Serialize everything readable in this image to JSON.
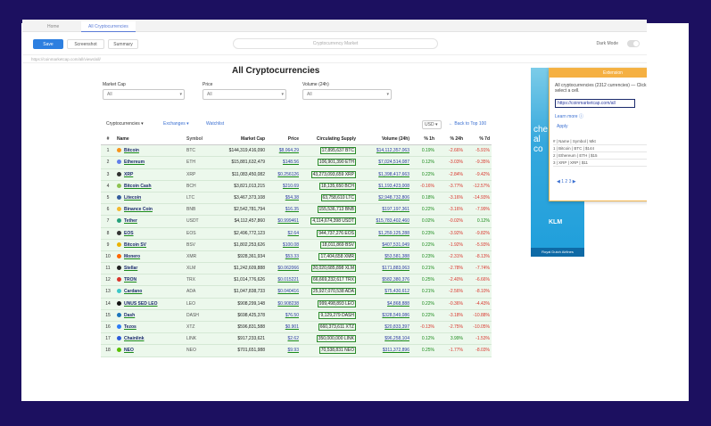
{
  "browser": {
    "tabs": [
      "Home",
      "All Cryptocurrencies"
    ],
    "toolbar_buttons": [
      "Save",
      "Screenshot",
      "Summary"
    ],
    "search_placeholder": "Cryptocurrency Market",
    "right_label": "Dark Mode",
    "url": "https://coinmarketcap.com/all/views/all/"
  },
  "page": {
    "title": "All Cryptocurrencies",
    "filters": [
      {
        "label": "Market Cap",
        "value": "All"
      },
      {
        "label": "Price",
        "value": "All"
      },
      {
        "label": "Volume (24h)",
        "value": "All"
      }
    ],
    "tabs": [
      "Cryptocurrencies ▾",
      "Exchanges ▾",
      "Watchlist"
    ],
    "currency": "USD ▾",
    "back_link": "← Back to Top 100"
  },
  "table": {
    "headers": [
      "#",
      "Name",
      "Symbol",
      "Market Cap",
      "Price",
      "Circulating Supply",
      "Volume (24h)",
      "% 1h",
      "% 24h",
      "% 7d"
    ],
    "rows": [
      {
        "rank": "1",
        "name": "Bitcoin",
        "symbol": "BTC",
        "mcap": "$144,319,416,090",
        "price": "$8,064.29",
        "supply": "17,895,637 BTC",
        "vol": "$14,112,357,063",
        "h1": "0.19%",
        "h24": "-2.66%",
        "d7": "-5.91%",
        "icon_color": "#f7931a"
      },
      {
        "rank": "2",
        "name": "Ethereum",
        "symbol": "ETH",
        "mcap": "$15,881,632,479",
        "price": "$148.56",
        "supply": "106,901,390 ETH",
        "vol": "$7,024,514,087",
        "h1": "0.12%",
        "h24": "-3.03%",
        "d7": "-9.35%",
        "icon_color": "#627eea"
      },
      {
        "rank": "3",
        "name": "XRP",
        "symbol": "XRP",
        "mcap": "$11,083,450,082",
        "price": "$0.256126",
        "supply": "43,273,093,659 XRP",
        "vol": "$1,398,417,663",
        "h1": "0.22%",
        "h24": "-2.84%",
        "d7": "-9.42%",
        "icon_color": "#2f2f2f"
      },
      {
        "rank": "4",
        "name": "Bitcoin Cash",
        "symbol": "BCH",
        "mcap": "$3,821,013,215",
        "price": "$210.69",
        "supply": "18,135,650 BCH",
        "vol": "$1,193,423,008",
        "h1": "-0.16%",
        "h24": "-3.77%",
        "d7": "-12.57%",
        "icon_color": "#8dc351"
      },
      {
        "rank": "5",
        "name": "Litecoin",
        "symbol": "LTC",
        "mcap": "$3,467,373,108",
        "price": "$54.38",
        "supply": "63,758,610 LTC",
        "vol": "$2,948,732,806",
        "h1": "0.18%",
        "h24": "-3.16%",
        "d7": "-14.93%",
        "icon_color": "#345d9d"
      },
      {
        "rank": "6",
        "name": "Binance Coin",
        "symbol": "BNB",
        "mcap": "$2,542,781,794",
        "price": "$16.35",
        "supply": "155,536,713 BNB",
        "vol": "$197,197,361",
        "h1": "0.22%",
        "h24": "-3.16%",
        "d7": "-7.99%",
        "icon_color": "#f3ba2f"
      },
      {
        "rank": "7",
        "name": "Tether",
        "symbol": "USDT",
        "mcap": "$4,112,457,860",
        "price": "$0.999461",
        "supply": "4,114,674,398 USDT",
        "vol": "$15,783,402,460",
        "h1": "0.02%",
        "h24": "-0.02%",
        "d7": "0.12%",
        "icon_color": "#26a17b"
      },
      {
        "rank": "8",
        "name": "EOS",
        "symbol": "EOS",
        "mcap": "$2,496,772,123",
        "price": "$2.64",
        "supply": "944,737,276 EOS",
        "vol": "$1,259,125,288",
        "h1": "0.23%",
        "h24": "-3.92%",
        "d7": "-9.82%",
        "icon_color": "#333333"
      },
      {
        "rank": "9",
        "name": "Bitcoin SV",
        "symbol": "BSV",
        "mcap": "$1,802,253,626",
        "price": "$100.08",
        "supply": "18,011,869 BSV",
        "vol": "$407,531,049",
        "h1": "0.22%",
        "h24": "-1.92%",
        "d7": "-5.93%",
        "icon_color": "#eab300"
      },
      {
        "rank": "10",
        "name": "Monero",
        "symbol": "XMR",
        "mcap": "$928,361,934",
        "price": "$53.33",
        "supply": "17,404,658 XMR",
        "vol": "$53,581,388",
        "h1": "0.23%",
        "h24": "-2.31%",
        "d7": "-8.13%",
        "icon_color": "#ff6600"
      },
      {
        "rank": "11",
        "name": "Stellar",
        "symbol": "XLM",
        "mcap": "$1,242,609,888",
        "price": "$0.062066",
        "supply": "20,020,685,898 XLM",
        "vol": "$171,883,063",
        "h1": "0.21%",
        "h24": "-2.78%",
        "d7": "-7.74%",
        "icon_color": "#222222"
      },
      {
        "rank": "12",
        "name": "TRON",
        "symbol": "TRX",
        "mcap": "$1,014,776,626",
        "price": "$0.015221",
        "supply": "66,669,232,617 TRX",
        "vol": "$582,380,376",
        "h1": "0.25%",
        "h24": "-2.40%",
        "d7": "-6.66%",
        "icon_color": "#d9342b"
      },
      {
        "rank": "13",
        "name": "Cardano",
        "symbol": "ADA",
        "mcap": "$1,047,838,733",
        "price": "$0.040416",
        "supply": "25,927,070,538 ADA",
        "vol": "$75,430,612",
        "h1": "0.21%",
        "h24": "-2.56%",
        "d7": "-8.10%",
        "icon_color": "#3cc8c8"
      },
      {
        "rank": "14",
        "name": "UNUS SED LEO",
        "symbol": "LEO",
        "mcap": "$908,299,148",
        "price": "$0.908238",
        "supply": "999,498,893 LEO",
        "vol": "$4,868,888",
        "h1": "0.22%",
        "h24": "-0.36%",
        "d7": "-4.43%",
        "icon_color": "#111111"
      },
      {
        "rank": "15",
        "name": "Dash",
        "symbol": "DASH",
        "mcap": "$698,425,378",
        "price": "$76.50",
        "supply": "9,129,279 DASH",
        "vol": "$328,549,086",
        "h1": "0.22%",
        "h24": "-3.18%",
        "d7": "-10.88%",
        "icon_color": "#1c75bc"
      },
      {
        "rank": "16",
        "name": "Tezos",
        "symbol": "XTZ",
        "mcap": "$596,831,588",
        "price": "$0.901",
        "supply": "660,373,611 XTZ",
        "vol": "$20,833,397",
        "h1": "-0.13%",
        "h24": "-2.75%",
        "d7": "-10.05%",
        "icon_color": "#2c7df7"
      },
      {
        "rank": "17",
        "name": "Chainlink",
        "symbol": "LINK",
        "mcap": "$917,233,621",
        "price": "$2.62",
        "supply": "350,000,000 LINK",
        "vol": "$96,258,104",
        "h1": "0.12%",
        "h24": "3.99%",
        "d7": "-1.53%",
        "icon_color": "#2a5ada"
      },
      {
        "rank": "18",
        "name": "NEO",
        "symbol": "NEO",
        "mcap": "$701,651,988",
        "price": "$9.93",
        "supply": "70,538,831 NEO",
        "vol": "$311,372,896",
        "h1": "0.25%",
        "h24": "-1.77%",
        "d7": "-8.03%",
        "icon_color": "#58bf00"
      }
    ]
  },
  "popup": {
    "header": "Extension",
    "text": "All cryptocurrencies (2312 currencies) — Click to select a cell.",
    "input_value": "https://coinmarketcap.com/all",
    "link": "Learn more ⓘ",
    "button": "Apply",
    "mini_rows": [
      "# | Name | Symbol | Mkt",
      "1 | Bitcoin | BTC | $144",
      "2 | Ethereum | ETH | $15",
      "3 | XRP | XRP | $11"
    ],
    "pagination": "◀ 1 2 3 ▶"
  },
  "ad": {
    "text": "che\nal\nco",
    "logo": "KLM",
    "footer": "Royal Dutch Airlines"
  },
  "colors": {
    "accent": "#2d7fe0",
    "row_bg": "#ecf8ec",
    "positive": "#1a8a1a",
    "negative": "#d9342b",
    "background": "#1c1060"
  }
}
